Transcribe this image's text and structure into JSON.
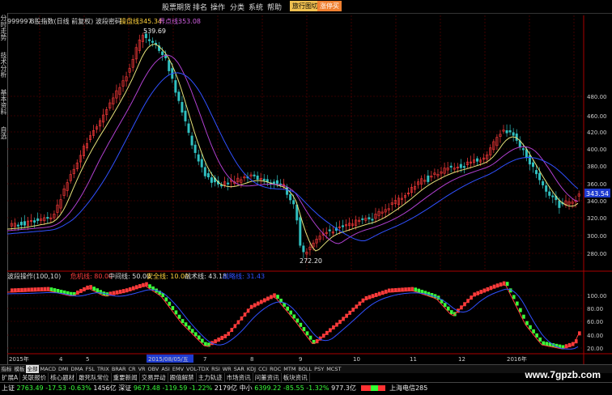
{
  "colors": {
    "up": "#ff3b3b",
    "down": "#3bff3b",
    "ma_yellow": "#e6e27a",
    "ma_purple": "#b040d0",
    "ma_blue": "#3050ff",
    "grid": "#7a0000",
    "bg": "#000000"
  },
  "menubar": {
    "items": [
      "股票期货",
      "排名",
      "操作",
      "分类",
      "系统",
      "帮助"
    ],
    "buttons": [
      "旅行图切换",
      "涨停买"
    ]
  },
  "sidebar": {
    "tabs": [
      "分时走势",
      "技术分析",
      "基本资料",
      "自选"
    ]
  },
  "main_header": {
    "code": "999997",
    "name": "B股指数(日线 前复权) 波段密码",
    "label1": "操盘线:",
    "value1": "345.34",
    "label2": "界点线:",
    "value2": "353.08"
  },
  "main_axis": {
    "ticks": [
      "480.00",
      "460.00",
      "420.00",
      "400.00",
      "380.00",
      "360.00",
      "340.00",
      "320.00",
      "300.00",
      "280.00"
    ],
    "current_price": "343.54"
  },
  "annotations": {
    "high": "539.69",
    "low": "272.20"
  },
  "indicator_header": {
    "title": "波段操作(100,10)",
    "items": [
      {
        "label": "危机线:",
        "value": "80.00",
        "color": "#ff3b3b"
      },
      {
        "label": "中间线:",
        "value": "50.00",
        "color": "#dddddd"
      },
      {
        "label": "安全线:",
        "value": "10.00",
        "color": "#ffd23c"
      },
      {
        "label": "战术线:",
        "value": "43.18",
        "color": "#dddddd"
      },
      {
        "label": "战略线:",
        "value": "31.43",
        "color": "#3050ff"
      }
    ]
  },
  "indicator_axis": {
    "ticks": [
      "100.00",
      "80.00",
      "60.00",
      "40.00",
      "20.00"
    ]
  },
  "time_axis": {
    "labels": [
      "2015年",
      "4",
      "5",
      "2015/08/05/五",
      "7",
      "8",
      "9",
      "10",
      "11",
      "12",
      "2016年"
    ]
  },
  "bottom_tabs": [
    "指标",
    "模板",
    "全部",
    "MACD",
    "DMI",
    "DMA",
    "FSL",
    "TRIX",
    "BRAR",
    "CR",
    "VR",
    "OBV",
    "ASI",
    "EMV",
    "VOL-TDX",
    "RSI",
    "WR",
    "SAR",
    "KDJ",
    "CCI",
    "ROC",
    "MTM",
    "BOLL",
    "PSY",
    "MCST"
  ],
  "bottom_tabs_active": 2,
  "links": [
    "扩展A",
    "关联报价",
    "核心题材",
    "敢死队常位",
    "重要新闻",
    "交易异动",
    "跟僖解禁",
    "主力轨迹",
    "市场资讯",
    "问董资讯",
    "板块资讯"
  ],
  "status": {
    "sh": "上证",
    "sh_val": "2763.49",
    "sh_chg": "-17.53",
    "sh_pct": "-0.63%",
    "sh_amt": "1456亿",
    "sz": "深证",
    "sz_val": "9673.48",
    "sz_chg": "-119.59",
    "sz_pct": "-1.22%",
    "sz_amt": "2179亿",
    "zx": "中小",
    "zx_val": "6399.22",
    "zx_chg": "-85.55",
    "zx_pct": "-1.32%",
    "zx_amt": "977.3亿",
    "server": "上海电信285"
  },
  "watermark": "www.7gpzb.com"
}
